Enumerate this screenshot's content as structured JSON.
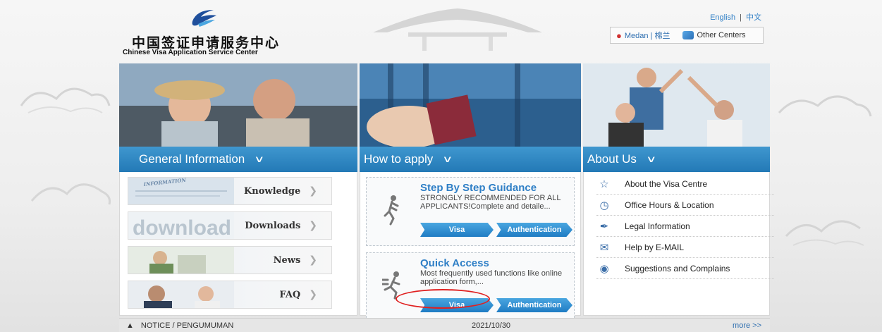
{
  "header": {
    "logo_cn": "中国签证申请服务中心",
    "logo_en": "Chinese Visa Application Service Center",
    "lang_en": "English",
    "lang_sep": "|",
    "lang_cn": "中文",
    "center_label": "Medan | 棉兰",
    "other_centers": "Other Centers"
  },
  "columns": {
    "general": {
      "title": "General Information",
      "items": [
        {
          "label": "Knowledge",
          "art": "INFORMATION"
        },
        {
          "label": "Downloads",
          "art": "download"
        },
        {
          "label": "News"
        },
        {
          "label": "FAQ"
        }
      ]
    },
    "apply": {
      "title": "How to apply",
      "step": {
        "title": "Step By Step Guidance",
        "desc": "STRONGLY RECOMMENDED FOR ALL APPLICANTS!Complete and detaile...",
        "visa": "Visa",
        "auth": "Authentication"
      },
      "quick": {
        "title": "Quick Access",
        "desc": "Most frequently used functions like online application form,...",
        "visa": "Visa",
        "auth": "Authentication"
      }
    },
    "about": {
      "title": "About Us",
      "items": [
        {
          "label": "About the Visa Centre",
          "icon": "star-icon"
        },
        {
          "label": "Office Hours & Location",
          "icon": "clock-icon"
        },
        {
          "label": "Legal Information",
          "icon": "pen-icon"
        },
        {
          "label": "Help by E-MAIL",
          "icon": "mail-icon"
        },
        {
          "label": "Suggestions and Complains",
          "icon": "chat-icon"
        }
      ]
    }
  },
  "notice": {
    "label": "NOTICE / PENGUMUMAN",
    "date": "2021/10/30",
    "more": "more >>"
  },
  "colors": {
    "accent": "#2f7fc6",
    "band": "#2379b6",
    "highlight": "#e02020"
  }
}
